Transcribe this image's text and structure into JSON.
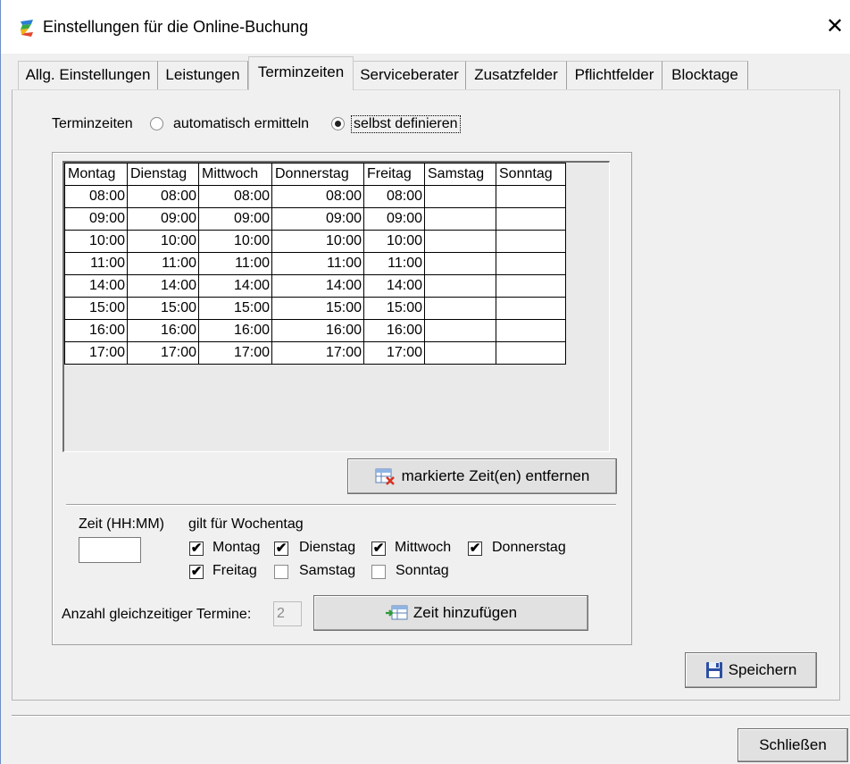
{
  "window": {
    "title": "Einstellungen für die Online-Buchung",
    "close_glyph": "✕",
    "icon": "app-logo-icon"
  },
  "tabs": [
    {
      "label": "Allg. Einstellungen",
      "active": false
    },
    {
      "label": "Leistungen",
      "active": false
    },
    {
      "label": "Terminzeiten",
      "active": true
    },
    {
      "label": "Serviceberater",
      "active": false
    },
    {
      "label": "Zusatzfelder",
      "active": false
    },
    {
      "label": "Pflichtfelder",
      "active": false
    },
    {
      "label": "Blocktage",
      "active": false
    }
  ],
  "mode": {
    "label": "Terminzeiten",
    "options": [
      {
        "label": "automatisch ermitteln",
        "checked": false
      },
      {
        "label": "selbst definieren",
        "checked": true
      }
    ]
  },
  "schedule": {
    "columns": [
      "Montag",
      "Dienstag",
      "Mittwoch",
      "Donnerstag",
      "Freitag",
      "Samstag",
      "Sonntag"
    ],
    "rows": [
      [
        "08:00",
        "08:00",
        "08:00",
        "08:00",
        "08:00",
        "",
        ""
      ],
      [
        "09:00",
        "09:00",
        "09:00",
        "09:00",
        "09:00",
        "",
        ""
      ],
      [
        "10:00",
        "10:00",
        "10:00",
        "10:00",
        "10:00",
        "",
        ""
      ],
      [
        "11:00",
        "11:00",
        "11:00",
        "11:00",
        "11:00",
        "",
        ""
      ],
      [
        "14:00",
        "14:00",
        "14:00",
        "14:00",
        "14:00",
        "",
        ""
      ],
      [
        "15:00",
        "15:00",
        "15:00",
        "15:00",
        "15:00",
        "",
        ""
      ],
      [
        "16:00",
        "16:00",
        "16:00",
        "16:00",
        "16:00",
        "",
        ""
      ],
      [
        "17:00",
        "17:00",
        "17:00",
        "17:00",
        "17:00",
        "",
        ""
      ]
    ]
  },
  "remove_button": {
    "label": "markierte Zeit(en) entfernen",
    "icon": "delete-table-icon"
  },
  "time_input": {
    "label": "Zeit (HH:MM)",
    "value": ""
  },
  "weekdays": {
    "label": "gilt für Wochentag",
    "items": [
      {
        "label": "Montag",
        "checked": true
      },
      {
        "label": "Dienstag",
        "checked": true
      },
      {
        "label": "Mittwoch",
        "checked": true
      },
      {
        "label": "Donnerstag",
        "checked": true
      },
      {
        "label": "Freitag",
        "checked": true
      },
      {
        "label": "Samstag",
        "checked": false
      },
      {
        "label": "Sonntag",
        "checked": false
      }
    ]
  },
  "concurrent": {
    "label": "Anzahl gleichzeitiger Termine:",
    "value": "2"
  },
  "add_button": {
    "label": "Zeit hinzufügen",
    "icon": "add-table-icon"
  },
  "save_button": {
    "label": "Speichern",
    "icon": "floppy-disk-icon"
  },
  "close_button": {
    "label": "Schließen"
  },
  "check_glyph": "✔",
  "colors": {
    "window_border": "#6c8fc6",
    "dialog_bg": "#f0f0f0",
    "button_bg": "#e1e1e1"
  }
}
